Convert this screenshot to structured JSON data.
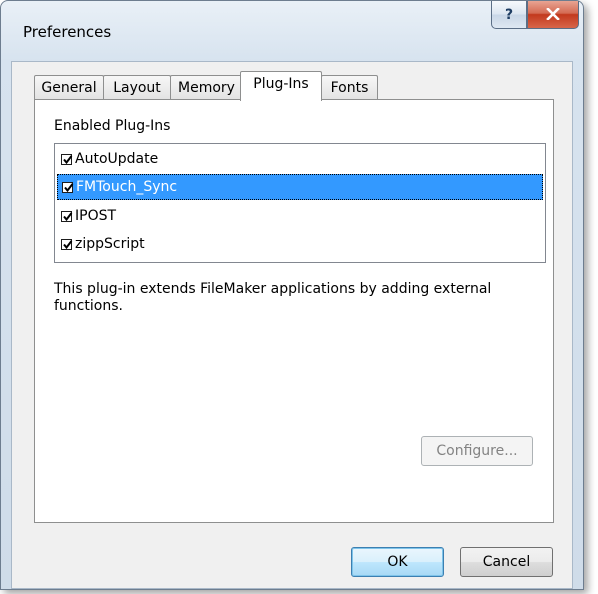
{
  "window": {
    "title": "Preferences",
    "help_glyph": "?",
    "close_glyph": "X"
  },
  "tabs": [
    {
      "label": "General",
      "active": false
    },
    {
      "label": "Layout",
      "active": false
    },
    {
      "label": "Memory",
      "active": false
    },
    {
      "label": "Plug-Ins",
      "active": true
    },
    {
      "label": "Fonts",
      "active": false
    }
  ],
  "plugins": {
    "section_label": "Enabled Plug-Ins",
    "items": [
      {
        "label": "AutoUpdate",
        "checked": true,
        "selected": false
      },
      {
        "label": "FMTouch_Sync",
        "checked": true,
        "selected": true
      },
      {
        "label": "IPOST",
        "checked": true,
        "selected": false
      },
      {
        "label": "zippScript",
        "checked": true,
        "selected": false
      }
    ],
    "description": "This plug-in extends FileMaker applications by adding external functions.",
    "configure_label": "Configure..."
  },
  "footer": {
    "ok_label": "OK",
    "cancel_label": "Cancel"
  },
  "colors": {
    "selection": "#3399ff",
    "close_button": "#c2391d"
  }
}
